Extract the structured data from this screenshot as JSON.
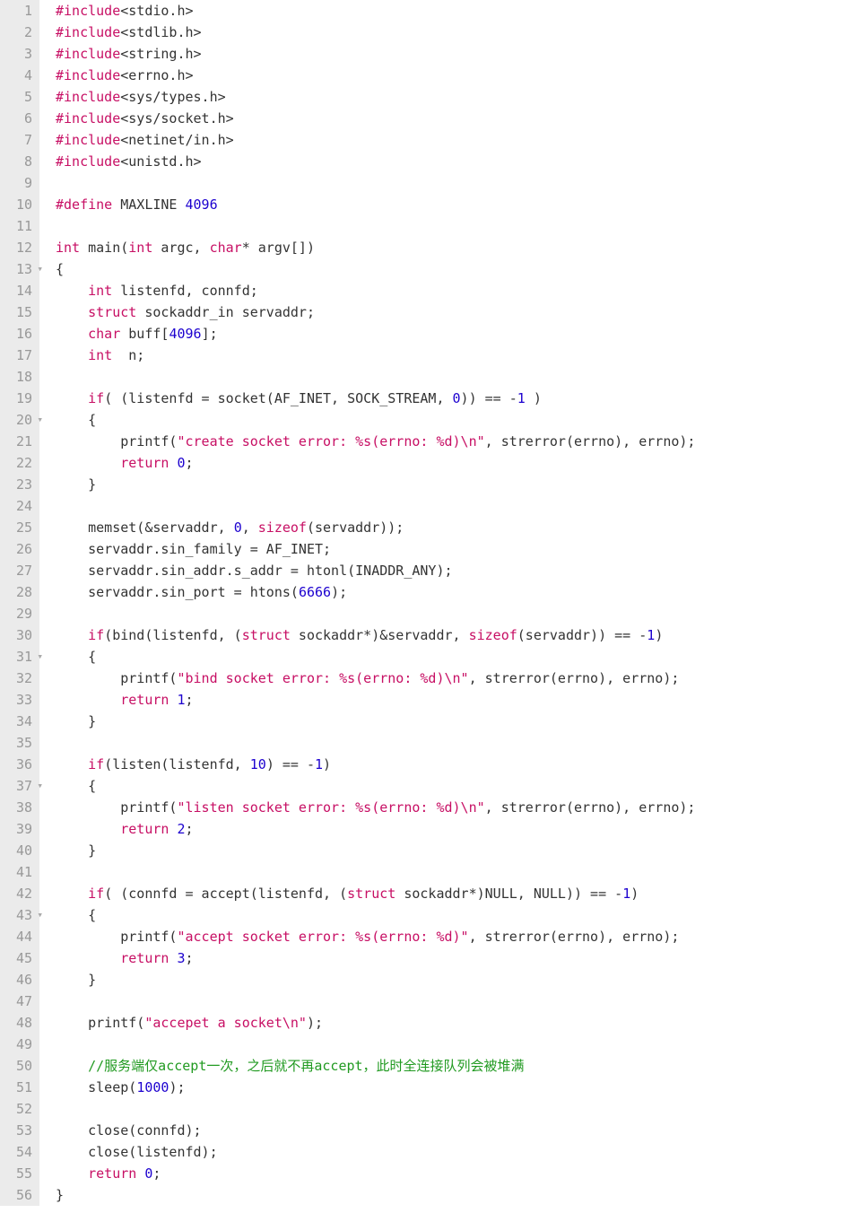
{
  "lines": [
    {
      "n": 1,
      "fold": false,
      "tokens": [
        {
          "c": "tok-pp",
          "t": "#include"
        },
        {
          "c": "tok-plain",
          "t": "<stdio.h>"
        }
      ]
    },
    {
      "n": 2,
      "fold": false,
      "tokens": [
        {
          "c": "tok-pp",
          "t": "#include"
        },
        {
          "c": "tok-plain",
          "t": "<stdlib.h>"
        }
      ]
    },
    {
      "n": 3,
      "fold": false,
      "tokens": [
        {
          "c": "tok-pp",
          "t": "#include"
        },
        {
          "c": "tok-plain",
          "t": "<string.h>"
        }
      ]
    },
    {
      "n": 4,
      "fold": false,
      "tokens": [
        {
          "c": "tok-pp",
          "t": "#include"
        },
        {
          "c": "tok-plain",
          "t": "<errno.h>"
        }
      ]
    },
    {
      "n": 5,
      "fold": false,
      "tokens": [
        {
          "c": "tok-pp",
          "t": "#include"
        },
        {
          "c": "tok-plain",
          "t": "<sys/types.h>"
        }
      ]
    },
    {
      "n": 6,
      "fold": false,
      "tokens": [
        {
          "c": "tok-pp",
          "t": "#include"
        },
        {
          "c": "tok-plain",
          "t": "<sys/socket.h>"
        }
      ]
    },
    {
      "n": 7,
      "fold": false,
      "tokens": [
        {
          "c": "tok-pp",
          "t": "#include"
        },
        {
          "c": "tok-plain",
          "t": "<netinet/in.h>"
        }
      ]
    },
    {
      "n": 8,
      "fold": false,
      "tokens": [
        {
          "c": "tok-pp",
          "t": "#include"
        },
        {
          "c": "tok-plain",
          "t": "<unistd.h>"
        }
      ]
    },
    {
      "n": 9,
      "fold": false,
      "tokens": []
    },
    {
      "n": 10,
      "fold": false,
      "tokens": [
        {
          "c": "tok-pp",
          "t": "#define"
        },
        {
          "c": "tok-plain",
          "t": " MAXLINE "
        },
        {
          "c": "tok-num",
          "t": "4096"
        }
      ]
    },
    {
      "n": 11,
      "fold": false,
      "tokens": []
    },
    {
      "n": 12,
      "fold": false,
      "tokens": [
        {
          "c": "tok-kw",
          "t": "int"
        },
        {
          "c": "tok-plain",
          "t": " main("
        },
        {
          "c": "tok-kw",
          "t": "int"
        },
        {
          "c": "tok-plain",
          "t": " argc, "
        },
        {
          "c": "tok-kw",
          "t": "char"
        },
        {
          "c": "tok-plain",
          "t": "* argv[])"
        }
      ]
    },
    {
      "n": 13,
      "fold": true,
      "tokens": [
        {
          "c": "tok-plain",
          "t": "{"
        }
      ]
    },
    {
      "n": 14,
      "fold": false,
      "tokens": [
        {
          "c": "tok-plain",
          "t": "    "
        },
        {
          "c": "tok-kw",
          "t": "int"
        },
        {
          "c": "tok-plain",
          "t": " listenfd, connfd;"
        }
      ]
    },
    {
      "n": 15,
      "fold": false,
      "tokens": [
        {
          "c": "tok-plain",
          "t": "    "
        },
        {
          "c": "tok-kw",
          "t": "struct"
        },
        {
          "c": "tok-plain",
          "t": " sockaddr_in servaddr;"
        }
      ]
    },
    {
      "n": 16,
      "fold": false,
      "tokens": [
        {
          "c": "tok-plain",
          "t": "    "
        },
        {
          "c": "tok-kw",
          "t": "char"
        },
        {
          "c": "tok-plain",
          "t": " buff["
        },
        {
          "c": "tok-num",
          "t": "4096"
        },
        {
          "c": "tok-plain",
          "t": "];"
        }
      ]
    },
    {
      "n": 17,
      "fold": false,
      "tokens": [
        {
          "c": "tok-plain",
          "t": "    "
        },
        {
          "c": "tok-kw",
          "t": "int"
        },
        {
          "c": "tok-plain",
          "t": "  n;"
        }
      ]
    },
    {
      "n": 18,
      "fold": false,
      "tokens": []
    },
    {
      "n": 19,
      "fold": false,
      "tokens": [
        {
          "c": "tok-plain",
          "t": "    "
        },
        {
          "c": "tok-kw",
          "t": "if"
        },
        {
          "c": "tok-plain",
          "t": "( (listenfd = socket(AF_INET, SOCK_STREAM, "
        },
        {
          "c": "tok-num",
          "t": "0"
        },
        {
          "c": "tok-plain",
          "t": ")) == -"
        },
        {
          "c": "tok-num",
          "t": "1"
        },
        {
          "c": "tok-plain",
          "t": " )"
        }
      ]
    },
    {
      "n": 20,
      "fold": true,
      "tokens": [
        {
          "c": "tok-plain",
          "t": "    {"
        }
      ]
    },
    {
      "n": 21,
      "fold": false,
      "tokens": [
        {
          "c": "tok-plain",
          "t": "        printf("
        },
        {
          "c": "tok-str",
          "t": "\"create socket error: %s(errno: %d)\\n\""
        },
        {
          "c": "tok-plain",
          "t": ", strerror(errno), errno);"
        }
      ]
    },
    {
      "n": 22,
      "fold": false,
      "tokens": [
        {
          "c": "tok-plain",
          "t": "        "
        },
        {
          "c": "tok-kw",
          "t": "return"
        },
        {
          "c": "tok-plain",
          "t": " "
        },
        {
          "c": "tok-num",
          "t": "0"
        },
        {
          "c": "tok-plain",
          "t": ";"
        }
      ]
    },
    {
      "n": 23,
      "fold": false,
      "tokens": [
        {
          "c": "tok-plain",
          "t": "    }"
        }
      ]
    },
    {
      "n": 24,
      "fold": false,
      "tokens": []
    },
    {
      "n": 25,
      "fold": false,
      "tokens": [
        {
          "c": "tok-plain",
          "t": "    memset(&servaddr, "
        },
        {
          "c": "tok-num",
          "t": "0"
        },
        {
          "c": "tok-plain",
          "t": ", "
        },
        {
          "c": "tok-kw",
          "t": "sizeof"
        },
        {
          "c": "tok-plain",
          "t": "(servaddr));"
        }
      ]
    },
    {
      "n": 26,
      "fold": false,
      "tokens": [
        {
          "c": "tok-plain",
          "t": "    servaddr.sin_family = AF_INET;"
        }
      ]
    },
    {
      "n": 27,
      "fold": false,
      "tokens": [
        {
          "c": "tok-plain",
          "t": "    servaddr.sin_addr.s_addr = htonl(INADDR_ANY);"
        }
      ]
    },
    {
      "n": 28,
      "fold": false,
      "tokens": [
        {
          "c": "tok-plain",
          "t": "    servaddr.sin_port = htons("
        },
        {
          "c": "tok-num",
          "t": "6666"
        },
        {
          "c": "tok-plain",
          "t": ");"
        }
      ]
    },
    {
      "n": 29,
      "fold": false,
      "tokens": []
    },
    {
      "n": 30,
      "fold": false,
      "tokens": [
        {
          "c": "tok-plain",
          "t": "    "
        },
        {
          "c": "tok-kw",
          "t": "if"
        },
        {
          "c": "tok-plain",
          "t": "(bind(listenfd, ("
        },
        {
          "c": "tok-kw",
          "t": "struct"
        },
        {
          "c": "tok-plain",
          "t": " sockaddr*)&servaddr, "
        },
        {
          "c": "tok-kw",
          "t": "sizeof"
        },
        {
          "c": "tok-plain",
          "t": "(servaddr)) == -"
        },
        {
          "c": "tok-num",
          "t": "1"
        },
        {
          "c": "tok-plain",
          "t": ")"
        }
      ]
    },
    {
      "n": 31,
      "fold": true,
      "tokens": [
        {
          "c": "tok-plain",
          "t": "    {"
        }
      ]
    },
    {
      "n": 32,
      "fold": false,
      "tokens": [
        {
          "c": "tok-plain",
          "t": "        printf("
        },
        {
          "c": "tok-str",
          "t": "\"bind socket error: %s(errno: %d)\\n\""
        },
        {
          "c": "tok-plain",
          "t": ", strerror(errno), errno);"
        }
      ]
    },
    {
      "n": 33,
      "fold": false,
      "tokens": [
        {
          "c": "tok-plain",
          "t": "        "
        },
        {
          "c": "tok-kw",
          "t": "return"
        },
        {
          "c": "tok-plain",
          "t": " "
        },
        {
          "c": "tok-num",
          "t": "1"
        },
        {
          "c": "tok-plain",
          "t": ";"
        }
      ]
    },
    {
      "n": 34,
      "fold": false,
      "tokens": [
        {
          "c": "tok-plain",
          "t": "    }"
        }
      ]
    },
    {
      "n": 35,
      "fold": false,
      "tokens": []
    },
    {
      "n": 36,
      "fold": false,
      "tokens": [
        {
          "c": "tok-plain",
          "t": "    "
        },
        {
          "c": "tok-kw",
          "t": "if"
        },
        {
          "c": "tok-plain",
          "t": "(listen(listenfd, "
        },
        {
          "c": "tok-num",
          "t": "10"
        },
        {
          "c": "tok-plain",
          "t": ") == -"
        },
        {
          "c": "tok-num",
          "t": "1"
        },
        {
          "c": "tok-plain",
          "t": ")"
        }
      ]
    },
    {
      "n": 37,
      "fold": true,
      "tokens": [
        {
          "c": "tok-plain",
          "t": "    {"
        }
      ]
    },
    {
      "n": 38,
      "fold": false,
      "tokens": [
        {
          "c": "tok-plain",
          "t": "        printf("
        },
        {
          "c": "tok-str",
          "t": "\"listen socket error: %s(errno: %d)\\n\""
        },
        {
          "c": "tok-plain",
          "t": ", strerror(errno), errno);"
        }
      ]
    },
    {
      "n": 39,
      "fold": false,
      "tokens": [
        {
          "c": "tok-plain",
          "t": "        "
        },
        {
          "c": "tok-kw",
          "t": "return"
        },
        {
          "c": "tok-plain",
          "t": " "
        },
        {
          "c": "tok-num",
          "t": "2"
        },
        {
          "c": "tok-plain",
          "t": ";"
        }
      ]
    },
    {
      "n": 40,
      "fold": false,
      "tokens": [
        {
          "c": "tok-plain",
          "t": "    }"
        }
      ]
    },
    {
      "n": 41,
      "fold": false,
      "tokens": []
    },
    {
      "n": 42,
      "fold": false,
      "tokens": [
        {
          "c": "tok-plain",
          "t": "    "
        },
        {
          "c": "tok-kw",
          "t": "if"
        },
        {
          "c": "tok-plain",
          "t": "( (connfd = accept(listenfd, ("
        },
        {
          "c": "tok-kw",
          "t": "struct"
        },
        {
          "c": "tok-plain",
          "t": " sockaddr*)NULL, NULL)) == -"
        },
        {
          "c": "tok-num",
          "t": "1"
        },
        {
          "c": "tok-plain",
          "t": ")"
        }
      ]
    },
    {
      "n": 43,
      "fold": true,
      "tokens": [
        {
          "c": "tok-plain",
          "t": "    {"
        }
      ]
    },
    {
      "n": 44,
      "fold": false,
      "tokens": [
        {
          "c": "tok-plain",
          "t": "        printf("
        },
        {
          "c": "tok-str",
          "t": "\"accept socket error: %s(errno: %d)\""
        },
        {
          "c": "tok-plain",
          "t": ", strerror(errno), errno);"
        }
      ]
    },
    {
      "n": 45,
      "fold": false,
      "tokens": [
        {
          "c": "tok-plain",
          "t": "        "
        },
        {
          "c": "tok-kw",
          "t": "return"
        },
        {
          "c": "tok-plain",
          "t": " "
        },
        {
          "c": "tok-num",
          "t": "3"
        },
        {
          "c": "tok-plain",
          "t": ";"
        }
      ]
    },
    {
      "n": 46,
      "fold": false,
      "tokens": [
        {
          "c": "tok-plain",
          "t": "    }"
        }
      ]
    },
    {
      "n": 47,
      "fold": false,
      "tokens": []
    },
    {
      "n": 48,
      "fold": false,
      "tokens": [
        {
          "c": "tok-plain",
          "t": "    printf("
        },
        {
          "c": "tok-str",
          "t": "\"accepet a socket\\n\""
        },
        {
          "c": "tok-plain",
          "t": ");"
        }
      ]
    },
    {
      "n": 49,
      "fold": false,
      "tokens": []
    },
    {
      "n": 50,
      "fold": false,
      "tokens": [
        {
          "c": "tok-plain",
          "t": "    "
        },
        {
          "c": "tok-cmt",
          "t": "//服务端仅accept一次，之后就不再accept，此时全连接队列会被堆满"
        }
      ]
    },
    {
      "n": 51,
      "fold": false,
      "tokens": [
        {
          "c": "tok-plain",
          "t": "    sleep("
        },
        {
          "c": "tok-num",
          "t": "1000"
        },
        {
          "c": "tok-plain",
          "t": ");"
        }
      ]
    },
    {
      "n": 52,
      "fold": false,
      "tokens": []
    },
    {
      "n": 53,
      "fold": false,
      "tokens": [
        {
          "c": "tok-plain",
          "t": "    close(connfd);"
        }
      ]
    },
    {
      "n": 54,
      "fold": false,
      "tokens": [
        {
          "c": "tok-plain",
          "t": "    close(listenfd);"
        }
      ]
    },
    {
      "n": 55,
      "fold": false,
      "tokens": [
        {
          "c": "tok-plain",
          "t": "    "
        },
        {
          "c": "tok-kw",
          "t": "return"
        },
        {
          "c": "tok-plain",
          "t": " "
        },
        {
          "c": "tok-num",
          "t": "0"
        },
        {
          "c": "tok-plain",
          "t": ";"
        }
      ]
    },
    {
      "n": 56,
      "fold": false,
      "tokens": [
        {
          "c": "tok-plain",
          "t": "}"
        }
      ]
    }
  ]
}
